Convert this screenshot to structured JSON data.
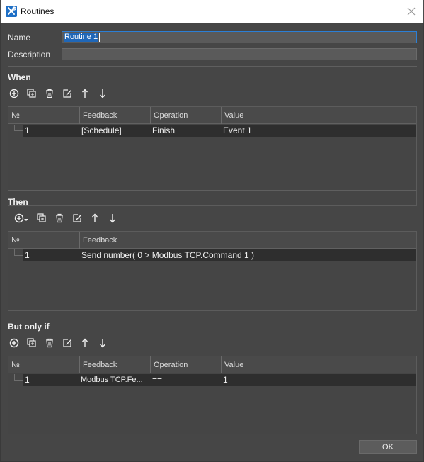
{
  "window": {
    "title": "Routines",
    "icon": "routines-app-icon"
  },
  "form": {
    "name_label": "Name",
    "name_value": "Routine 1",
    "description_label": "Description",
    "description_value": ""
  },
  "when": {
    "title": "When",
    "toolbar": [
      "add-icon",
      "copy-icon",
      "delete-icon",
      "edit-icon",
      "arrow-up-icon",
      "arrow-down-icon"
    ],
    "columns": [
      "№",
      "Feedback",
      "Operation",
      "Value"
    ],
    "rows": [
      {
        "no": "1",
        "feedback": "[Schedule]",
        "operation": "Finish",
        "value": "Event 1"
      }
    ]
  },
  "then": {
    "title": "Then",
    "toolbar": [
      "add-dropdown-icon",
      "copy-icon",
      "delete-icon",
      "edit-icon",
      "arrow-up-icon",
      "arrow-down-icon"
    ],
    "columns": [
      "№",
      "Feedback"
    ],
    "rows": [
      {
        "no": "1",
        "feedback": "Send number( 0 > Modbus TCP.Command 1 )"
      }
    ]
  },
  "but_only_if": {
    "title": "But only if",
    "toolbar": [
      "add-icon",
      "copy-icon",
      "delete-icon",
      "edit-icon",
      "arrow-up-icon",
      "arrow-down-icon"
    ],
    "columns": [
      "№",
      "Feedback",
      "Operation",
      "Value"
    ],
    "rows": [
      {
        "no": "1",
        "feedback": "Modbus TCP.Fe...",
        "operation": "==",
        "value": "1"
      }
    ]
  },
  "buttons": {
    "ok": "OK"
  },
  "colors": {
    "background": "#464646",
    "selected_row": "#2e2e2e",
    "accent": "#2b7fd6"
  }
}
